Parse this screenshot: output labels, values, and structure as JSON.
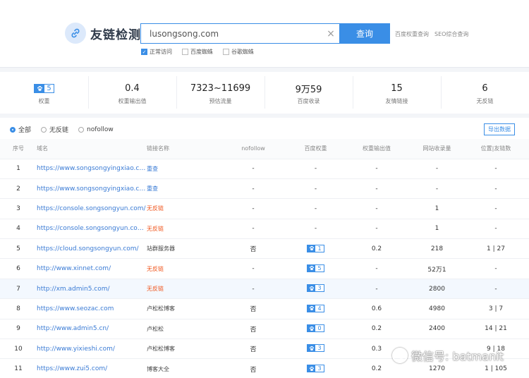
{
  "header": {
    "logo_text": "友链检测",
    "search": {
      "value": "lusongsong.com",
      "button": "查询"
    },
    "ext_links": [
      "百度权重查询",
      "SEO综合查询"
    ],
    "options": [
      {
        "label": "正常访问",
        "checked": true
      },
      {
        "label": "百度蜘蛛",
        "checked": false
      },
      {
        "label": "谷歌蜘蛛",
        "checked": false
      }
    ]
  },
  "stats": [
    {
      "value": "5",
      "label": "权重",
      "badge": true
    },
    {
      "value": "0.4",
      "label": "权重输出值"
    },
    {
      "value": "7323~11699",
      "label": "预估流量"
    },
    {
      "value": "9万59",
      "label": "百度收录"
    },
    {
      "value": "15",
      "label": "友情链接"
    },
    {
      "value": "6",
      "label": "无反链"
    }
  ],
  "filters": [
    {
      "label": "全部",
      "selected": true
    },
    {
      "label": "无反链",
      "selected": false
    },
    {
      "label": "nofollow",
      "selected": false
    }
  ],
  "export_label": "导出数据",
  "table": {
    "columns": [
      "序号",
      "域名",
      "链接名称",
      "nofollow",
      "百度权重",
      "权重输出值",
      "网站收录量",
      "位置|友链数"
    ],
    "rows": [
      {
        "no": "1",
        "domain": "https://www.songsongyingxiao.com/",
        "anchor": "重查",
        "status": "recheck",
        "nofollow": "-",
        "weight": "",
        "output": "-",
        "indexed": "-",
        "position": "-"
      },
      {
        "no": "2",
        "domain": "https://www.songsongyingxiao.co...",
        "anchor": "重查",
        "status": "recheck",
        "nofollow": "-",
        "weight": "",
        "output": "-",
        "indexed": "-",
        "position": "-"
      },
      {
        "no": "3",
        "domain": "https://console.songsongyun.com/",
        "anchor": "无反链",
        "status": "nofollow",
        "nofollow": "-",
        "weight": "",
        "output": "-",
        "indexed": "1",
        "position": "-"
      },
      {
        "no": "4",
        "domain": "https://console.songsongyun.com/l...",
        "anchor": "无反链",
        "status": "nofollow",
        "nofollow": "-",
        "weight": "",
        "output": "-",
        "indexed": "1",
        "position": "-"
      },
      {
        "no": "5",
        "domain": "https://cloud.songsongyun.com/",
        "anchor": "站群服务器",
        "status": "normal",
        "nofollow": "否",
        "weight": "1",
        "output": "0.2",
        "indexed": "218",
        "position": "1 | 27"
      },
      {
        "no": "6",
        "domain": "http://www.xinnet.com/",
        "anchor": "无反链",
        "status": "nofollow",
        "nofollow": "-",
        "weight": "5",
        "output": "-",
        "indexed": "52万1",
        "position": "-"
      },
      {
        "no": "7",
        "domain": "http://xm.admin5.com/",
        "anchor": "无反链",
        "status": "nofollow",
        "nofollow": "-",
        "weight": "3",
        "output": "-",
        "indexed": "2800",
        "position": "-"
      },
      {
        "no": "8",
        "domain": "https://www.seozac.com",
        "anchor": "卢松松博客",
        "status": "normal",
        "nofollow": "否",
        "weight": "4",
        "output": "0.6",
        "indexed": "4980",
        "position": "3 | 7"
      },
      {
        "no": "9",
        "domain": "http://www.admin5.cn/",
        "anchor": "卢松松",
        "status": "normal",
        "nofollow": "否",
        "weight": "0",
        "output": "0.2",
        "indexed": "2400",
        "position": "14 | 21"
      },
      {
        "no": "10",
        "domain": "http://www.yixieshi.com/",
        "anchor": "卢松松博客",
        "status": "normal",
        "nofollow": "否",
        "weight": "3",
        "output": "0.3",
        "indexed": "",
        "position": "9 | 18"
      },
      {
        "no": "11",
        "domain": "https://www.zui5.com/",
        "anchor": "博客大全",
        "status": "normal",
        "nofollow": "否",
        "weight": "3",
        "output": "0.2",
        "indexed": "1270",
        "position": "1 | 105"
      }
    ],
    "highlighted_row": 7
  },
  "watermark": "微信号: batmanit",
  "colors": {
    "accent": "#3a8ee6",
    "link": "#3a7bd5",
    "warning": "#f0561e"
  },
  "icons": {
    "logo": "link-icon",
    "badge": "paw-icon",
    "watermark": "wechat-icon"
  }
}
